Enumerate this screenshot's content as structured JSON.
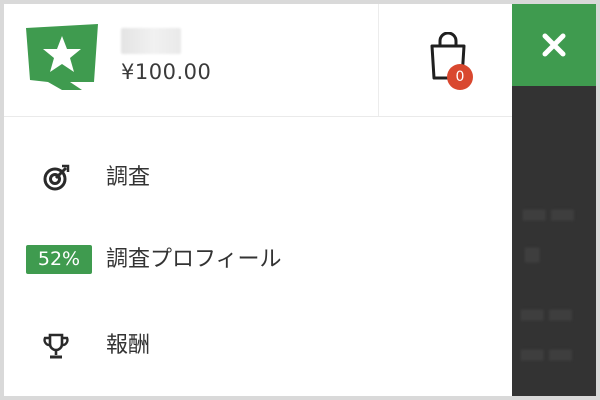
{
  "header": {
    "balance": "¥100.00",
    "cart": {
      "count": "0",
      "icon": "shopping-bag-icon"
    },
    "logo": {
      "icon": "star-speech-bubble-logo",
      "color": "#3f9b4f"
    }
  },
  "menu": {
    "items": [
      {
        "label": "調査",
        "icon": "target-icon"
      },
      {
        "label": "調査プロフィール",
        "badge": "52%"
      },
      {
        "label": "報酬",
        "icon": "trophy-icon"
      }
    ]
  },
  "close_button": {
    "icon": "close-icon",
    "color": "#3f9b4f"
  },
  "colors": {
    "accent": "#3f9b4f",
    "badge_red": "#d9482f",
    "backdrop": "#333333"
  }
}
